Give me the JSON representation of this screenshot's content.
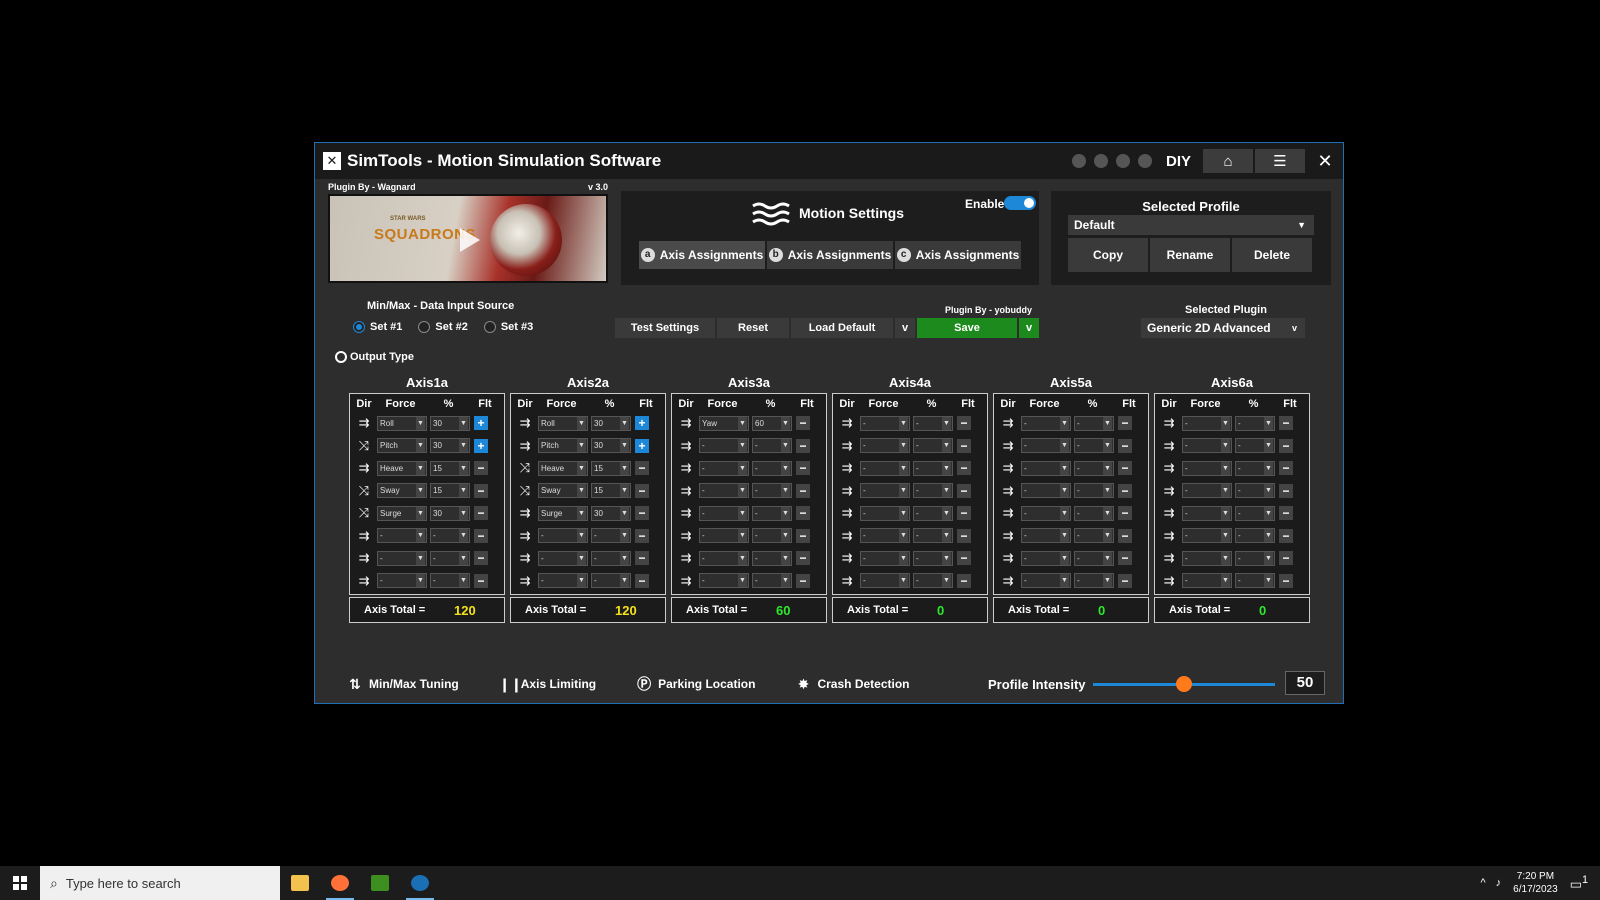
{
  "window": {
    "title": "SimTools - Motion Simulation Software",
    "logo": "✕",
    "mode": "DIY",
    "home_icon": "home-icon",
    "menu_icon": "menu-icon",
    "close_icon": "close-icon"
  },
  "plugin": {
    "by": "Plugin By - Wagnard",
    "version": "v 3.0",
    "game_title": "SQUADRONS",
    "game_sub": "STAR WARS"
  },
  "motion": {
    "title": "Motion Settings",
    "enable_label": "Enable",
    "enabled": true,
    "tabs": [
      {
        "badge": "a",
        "label": "Axis Assignments"
      },
      {
        "badge": "b",
        "label": "Axis Assignments"
      },
      {
        "badge": "c",
        "label": "Axis Assignments"
      }
    ]
  },
  "profile": {
    "title": "Selected Profile",
    "selected": "Default",
    "buttons": {
      "copy": "Copy",
      "rename": "Rename",
      "delete": "Delete"
    }
  },
  "input_source": {
    "label": "Min/Max - Data Input Source",
    "sets": [
      "Set #1",
      "Set #2",
      "Set #3"
    ],
    "selected_index": 0
  },
  "output_type": "Output Type",
  "actions": {
    "test": "Test Settings",
    "reset": "Reset",
    "load_default": "Load Default",
    "load_caret": "v",
    "save": "Save",
    "save_caret": "v",
    "plugin_by": "Plugin By - yobuddy"
  },
  "selected_plugin": {
    "label": "Selected Plugin",
    "value": "Generic 2D Advanced",
    "caret": "v"
  },
  "axis_headers": {
    "dir": "Dir",
    "force": "Force",
    "pct": "%",
    "flt": "Flt"
  },
  "axis_total_label": "Axis Total =",
  "axes": [
    {
      "name": "Axis1a",
      "total": "120",
      "total_color": "#f5e11a",
      "rows": [
        {
          "dir": "⇉",
          "force": "Roll",
          "pct": "30",
          "flt": "+"
        },
        {
          "dir": "⤨",
          "force": "Pitch",
          "pct": "30",
          "flt": "+"
        },
        {
          "dir": "⇉",
          "force": "Heave",
          "pct": "15",
          "flt": "−"
        },
        {
          "dir": "⤨",
          "force": "Sway",
          "pct": "15",
          "flt": "−"
        },
        {
          "dir": "⤨",
          "force": "Surge",
          "pct": "30",
          "flt": "−"
        },
        {
          "dir": "⇉",
          "force": "-",
          "pct": "-",
          "flt": "−"
        },
        {
          "dir": "⇉",
          "force": "-",
          "pct": "-",
          "flt": "−"
        },
        {
          "dir": "⇉",
          "force": "-",
          "pct": "-",
          "flt": "−"
        }
      ]
    },
    {
      "name": "Axis2a",
      "total": "120",
      "total_color": "#f5e11a",
      "rows": [
        {
          "dir": "⇉",
          "force": "Roll",
          "pct": "30",
          "flt": "+"
        },
        {
          "dir": "⇉",
          "force": "Pitch",
          "pct": "30",
          "flt": "+"
        },
        {
          "dir": "⤨",
          "force": "Heave",
          "pct": "15",
          "flt": "−"
        },
        {
          "dir": "⤨",
          "force": "Sway",
          "pct": "15",
          "flt": "−"
        },
        {
          "dir": "⇉",
          "force": "Surge",
          "pct": "30",
          "flt": "−"
        },
        {
          "dir": "⇉",
          "force": "-",
          "pct": "-",
          "flt": "−"
        },
        {
          "dir": "⇉",
          "force": "-",
          "pct": "-",
          "flt": "−"
        },
        {
          "dir": "⇉",
          "force": "-",
          "pct": "-",
          "flt": "−"
        }
      ]
    },
    {
      "name": "Axis3a",
      "total": "60",
      "total_color": "#2ee82e",
      "rows": [
        {
          "dir": "⇉",
          "force": "Yaw",
          "pct": "60",
          "flt": "−"
        },
        {
          "dir": "⇉",
          "force": "-",
          "pct": "-",
          "flt": "−"
        },
        {
          "dir": "⇉",
          "force": "-",
          "pct": "-",
          "flt": "−"
        },
        {
          "dir": "⇉",
          "force": "-",
          "pct": "-",
          "flt": "−"
        },
        {
          "dir": "⇉",
          "force": "-",
          "pct": "-",
          "flt": "−"
        },
        {
          "dir": "⇉",
          "force": "-",
          "pct": "-",
          "flt": "−"
        },
        {
          "dir": "⇉",
          "force": "-",
          "pct": "-",
          "flt": "−"
        },
        {
          "dir": "⇉",
          "force": "-",
          "pct": "-",
          "flt": "−"
        }
      ]
    },
    {
      "name": "Axis4a",
      "total": "0",
      "total_color": "#2ee82e",
      "rows": [
        {
          "dir": "⇉",
          "force": "-",
          "pct": "-",
          "flt": "−"
        },
        {
          "dir": "⇉",
          "force": "-",
          "pct": "-",
          "flt": "−"
        },
        {
          "dir": "⇉",
          "force": "-",
          "pct": "-",
          "flt": "−"
        },
        {
          "dir": "⇉",
          "force": "-",
          "pct": "-",
          "flt": "−"
        },
        {
          "dir": "⇉",
          "force": "-",
          "pct": "-",
          "flt": "−"
        },
        {
          "dir": "⇉",
          "force": "-",
          "pct": "-",
          "flt": "−"
        },
        {
          "dir": "⇉",
          "force": "-",
          "pct": "-",
          "flt": "−"
        },
        {
          "dir": "⇉",
          "force": "-",
          "pct": "-",
          "flt": "−"
        }
      ]
    },
    {
      "name": "Axis5a",
      "total": "0",
      "total_color": "#2ee82e",
      "rows": [
        {
          "dir": "⇉",
          "force": "-",
          "pct": "-",
          "flt": "−"
        },
        {
          "dir": "⇉",
          "force": "-",
          "pct": "-",
          "flt": "−"
        },
        {
          "dir": "⇉",
          "force": "-",
          "pct": "-",
          "flt": "−"
        },
        {
          "dir": "⇉",
          "force": "-",
          "pct": "-",
          "flt": "−"
        },
        {
          "dir": "⇉",
          "force": "-",
          "pct": "-",
          "flt": "−"
        },
        {
          "dir": "⇉",
          "force": "-",
          "pct": "-",
          "flt": "−"
        },
        {
          "dir": "⇉",
          "force": "-",
          "pct": "-",
          "flt": "−"
        },
        {
          "dir": "⇉",
          "force": "-",
          "pct": "-",
          "flt": "−"
        }
      ]
    },
    {
      "name": "Axis6a",
      "total": "0",
      "total_color": "#2ee82e",
      "rows": [
        {
          "dir": "⇉",
          "force": "-",
          "pct": "-",
          "flt": "−"
        },
        {
          "dir": "⇉",
          "force": "-",
          "pct": "-",
          "flt": "−"
        },
        {
          "dir": "⇉",
          "force": "-",
          "pct": "-",
          "flt": "−"
        },
        {
          "dir": "⇉",
          "force": "-",
          "pct": "-",
          "flt": "−"
        },
        {
          "dir": "⇉",
          "force": "-",
          "pct": "-",
          "flt": "−"
        },
        {
          "dir": "⇉",
          "force": "-",
          "pct": "-",
          "flt": "−"
        },
        {
          "dir": "⇉",
          "force": "-",
          "pct": "-",
          "flt": "−"
        },
        {
          "dir": "⇉",
          "force": "-",
          "pct": "-",
          "flt": "−"
        }
      ]
    }
  ],
  "bottom_nav": [
    {
      "icon": "⇅",
      "label": "Min/Max Tuning",
      "name": "minmax-tuning"
    },
    {
      "icon": "❙❙",
      "label": "Axis Limiting",
      "name": "axis-limiting"
    },
    {
      "icon": "Ⓟ",
      "label": "Parking Location",
      "name": "parking-location"
    },
    {
      "icon": "✸",
      "label": "Crash Detection",
      "name": "crash-detection"
    }
  ],
  "intensity": {
    "label": "Profile Intensity",
    "value": "50",
    "fraction": 0.5
  },
  "taskbar": {
    "search_placeholder": "Type here to search",
    "time": "7:20 PM",
    "date": "6/17/2023",
    "tray_chevron": "^",
    "volume_icon": "🔊",
    "notif_count": "1"
  },
  "colors": {
    "accent": "#1e88d8",
    "save": "#1d8a1d",
    "total_yellow": "#f5e11a",
    "total_green": "#2ee82e",
    "knob": "#ff7a1a"
  }
}
